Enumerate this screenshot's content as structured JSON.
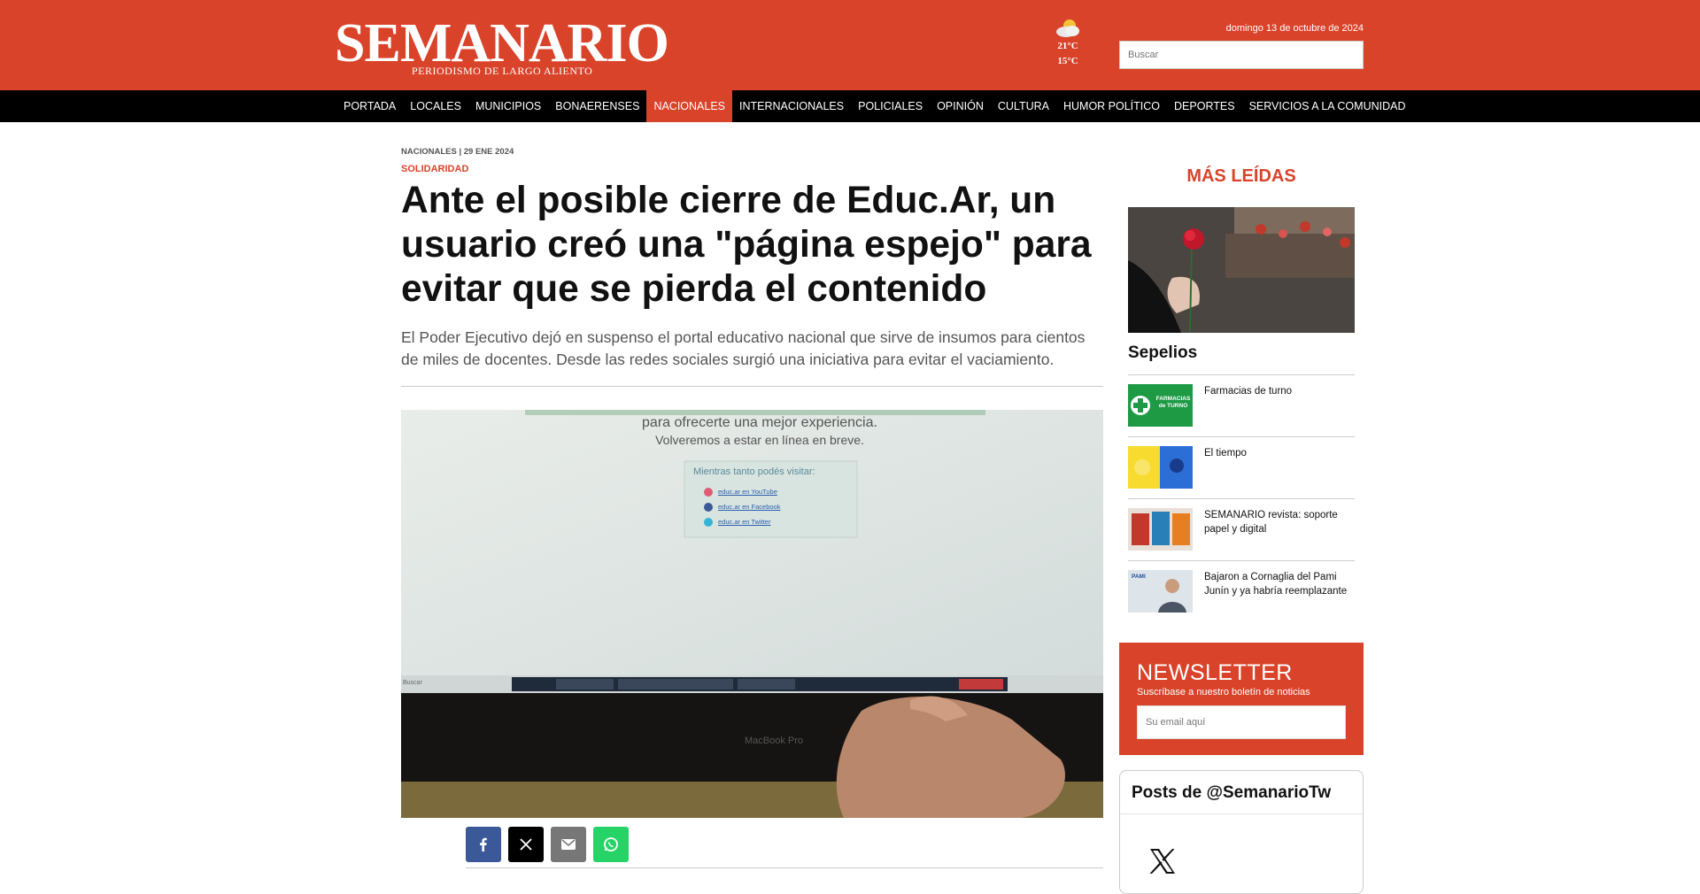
{
  "header": {
    "logo_text": "SEMANARIO",
    "logo_tagline": "PERIODISMO DE LARGO ALIENTO",
    "weather": {
      "icon": "partly-cloudy-icon",
      "temp_max": "21°C",
      "temp_min": "15°C"
    },
    "date": "domingo 13 de octubre de 2024",
    "search_placeholder": "Buscar"
  },
  "nav": {
    "items": [
      {
        "label": "PORTADA"
      },
      {
        "label": "LOCALES"
      },
      {
        "label": "MUNICIPIOS"
      },
      {
        "label": "BONAERENSES"
      },
      {
        "label": "NACIONALES",
        "active": true
      },
      {
        "label": "INTERNACIONALES"
      },
      {
        "label": "POLICIALES"
      },
      {
        "label": "OPINIÓN"
      },
      {
        "label": "CULTURA"
      },
      {
        "label": "HUMOR POLÍTICO"
      },
      {
        "label": "DEPORTES"
      },
      {
        "label": "SERVICIOS A LA COMUNIDAD"
      }
    ]
  },
  "article": {
    "kicker": "NACIONALES | 29 ENE 2024",
    "section": "SOLIDARIDAD",
    "title": "Ante el posible cierre de Educ.Ar, un usuario creó una \"página espejo\" para evitar que se pierda el contenido",
    "lead": "El Poder Ejecutivo dejó en suspenso el portal educativo nacional que sirve de insumos para cientos de miles de docentes. Desde las redes sociales surgió una iniciativa para evitar el vaciamiento.",
    "photo": {
      "screen_line1": "para ofrecerte una mejor experiencia.",
      "screen_line2": "Volveremos a estar en línea en breve.",
      "box_title": "Mientras tanto podés visitar:",
      "links": [
        "educ.ar en YouTube",
        "educ.ar en Facebook",
        "educ.ar en Twitter"
      ],
      "laptop_label": "MacBook Pro",
      "taskbar_search": "Buscar"
    },
    "share_icons": [
      "facebook-icon",
      "x-icon",
      "email-icon",
      "whatsapp-icon"
    ]
  },
  "sidebar": {
    "most_read_title": "MÁS LEÍDAS",
    "hero_title": "Sepelios",
    "items": [
      {
        "title": "Farmacias de turno",
        "thumb_text": "FARMACIAS de TURNO"
      },
      {
        "title": "El tiempo"
      },
      {
        "title": "SEMANARIO revista: soporte papel y digital"
      },
      {
        "title": "Bajaron a Cornaglia del Pami Junín y ya habría reemplazante",
        "thumb_text": "PAMI"
      }
    ],
    "newsletter": {
      "title": "NEWSLETTER",
      "subtitle": "Suscríbase a nuestro boletín de noticias",
      "placeholder": "Su email aquí"
    },
    "twitter_title": "Posts de @SemanarioTw"
  },
  "colors": {
    "brand_red": "#d9432a",
    "nav_black": "#000000",
    "facebook": "#3b5998",
    "whatsapp": "#25d366"
  }
}
